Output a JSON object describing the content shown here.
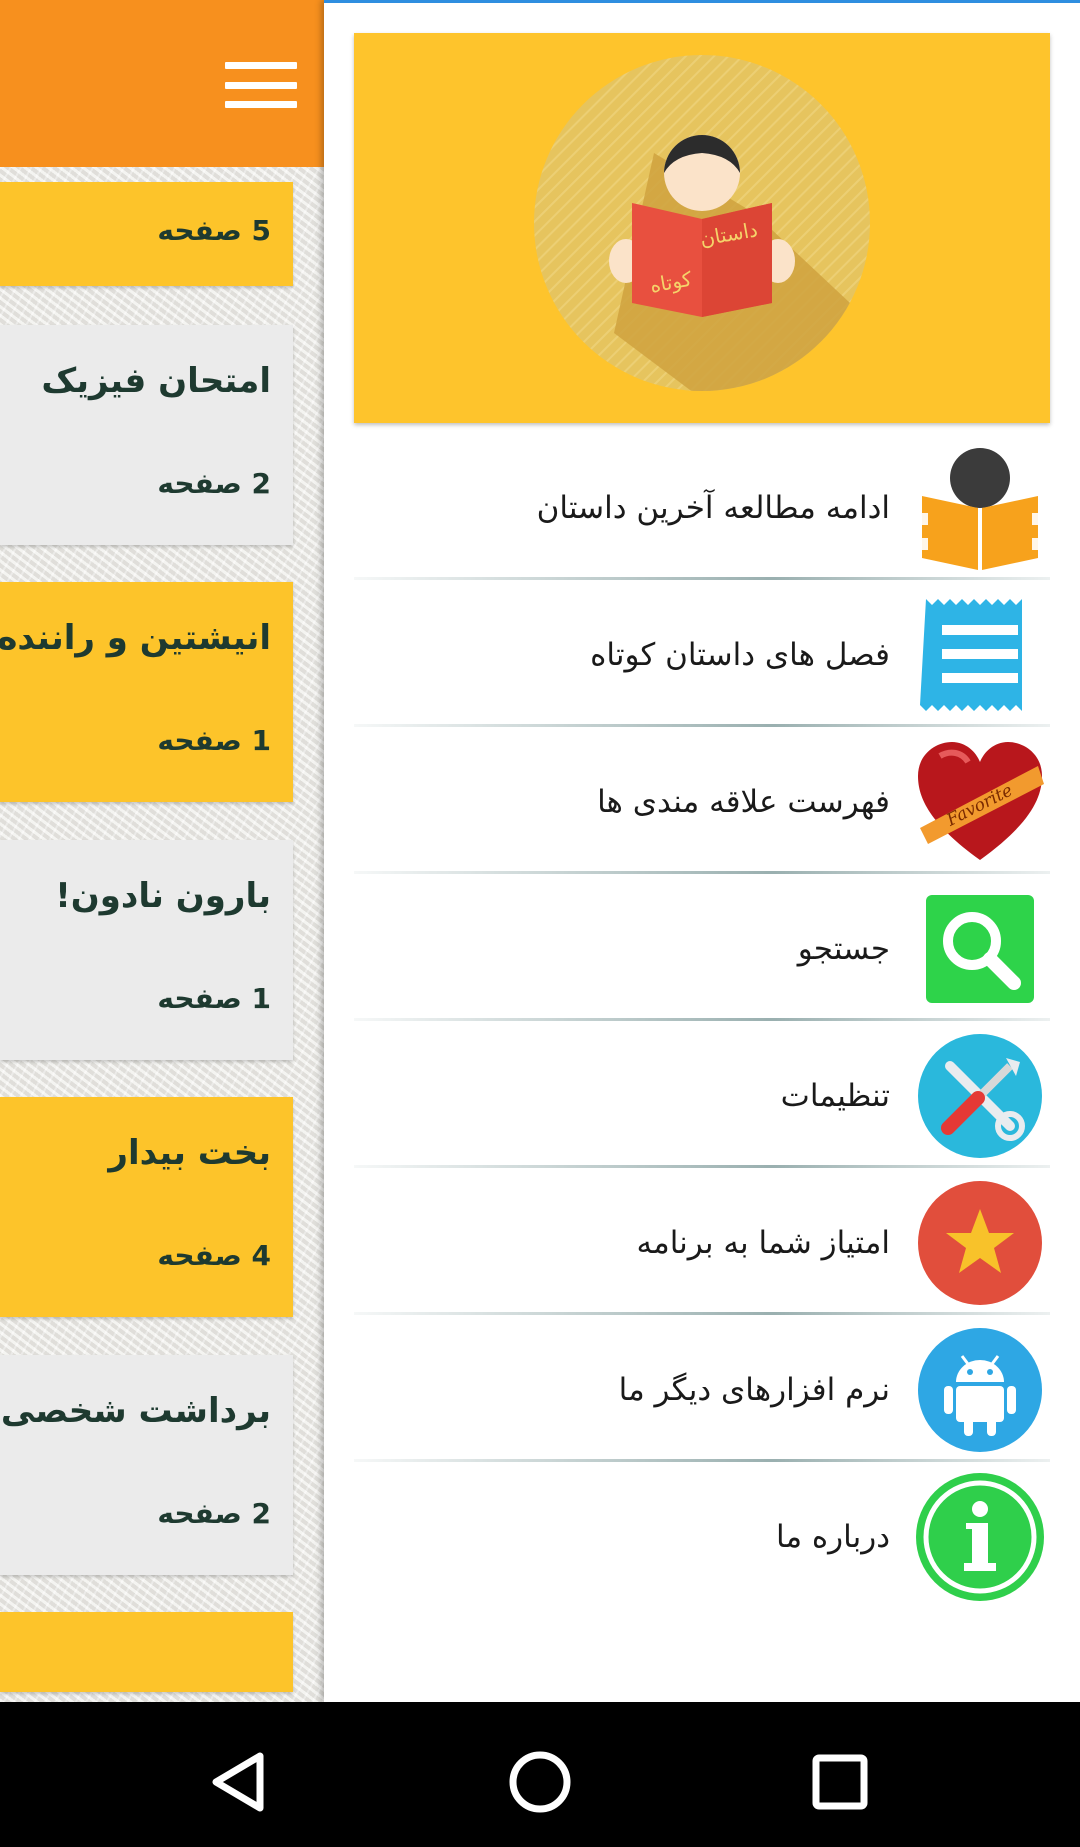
{
  "colors": {
    "appbar": "#f7901e",
    "card_yellow": "#fdc42a",
    "card_grey": "#ebebeb",
    "drawer_header": "#fec42c",
    "card_text": "#1e3a30"
  },
  "background_list": {
    "cards": [
      {
        "title": "",
        "pages": "5 صفحه",
        "color": "yellow"
      },
      {
        "title": "امتحان فیزیک",
        "pages": "2 صفحه",
        "color": "grey"
      },
      {
        "title": "انیشتین و راننده ا",
        "pages": "1 صفحه",
        "color": "yellow"
      },
      {
        "title": "بارون نادون!",
        "pages": "1 صفحه",
        "color": "grey"
      },
      {
        "title": "بخت بیدار",
        "pages": "4 صفحه",
        "color": "yellow"
      },
      {
        "title": "برداشت شخصی",
        "pages": "2 صفحه",
        "color": "grey"
      }
    ]
  },
  "drawer": {
    "header": {
      "book_line1": "داستان",
      "book_line2": "کوتاه"
    },
    "menu": [
      {
        "label": "ادامه مطالعه آخرین داستان",
        "icon": "reader-book-icon"
      },
      {
        "label": "فصل های داستان کوتاه",
        "icon": "list-icon"
      },
      {
        "label": "فهرست علاقه مندی ها",
        "icon": "favorite-heart-icon",
        "badge": "Favorite"
      },
      {
        "label": "جستجو",
        "icon": "search-icon"
      },
      {
        "label": "تنظیمات",
        "icon": "settings-tools-icon"
      },
      {
        "label": "امتیاز شما به برنامه",
        "icon": "star-icon"
      },
      {
        "label": "نرم افزارهای دیگر ما",
        "icon": "android-icon"
      },
      {
        "label": "درباره ما",
        "icon": "info-icon"
      }
    ]
  },
  "navbar": {
    "buttons": [
      "back-icon",
      "home-icon",
      "recents-icon"
    ]
  }
}
